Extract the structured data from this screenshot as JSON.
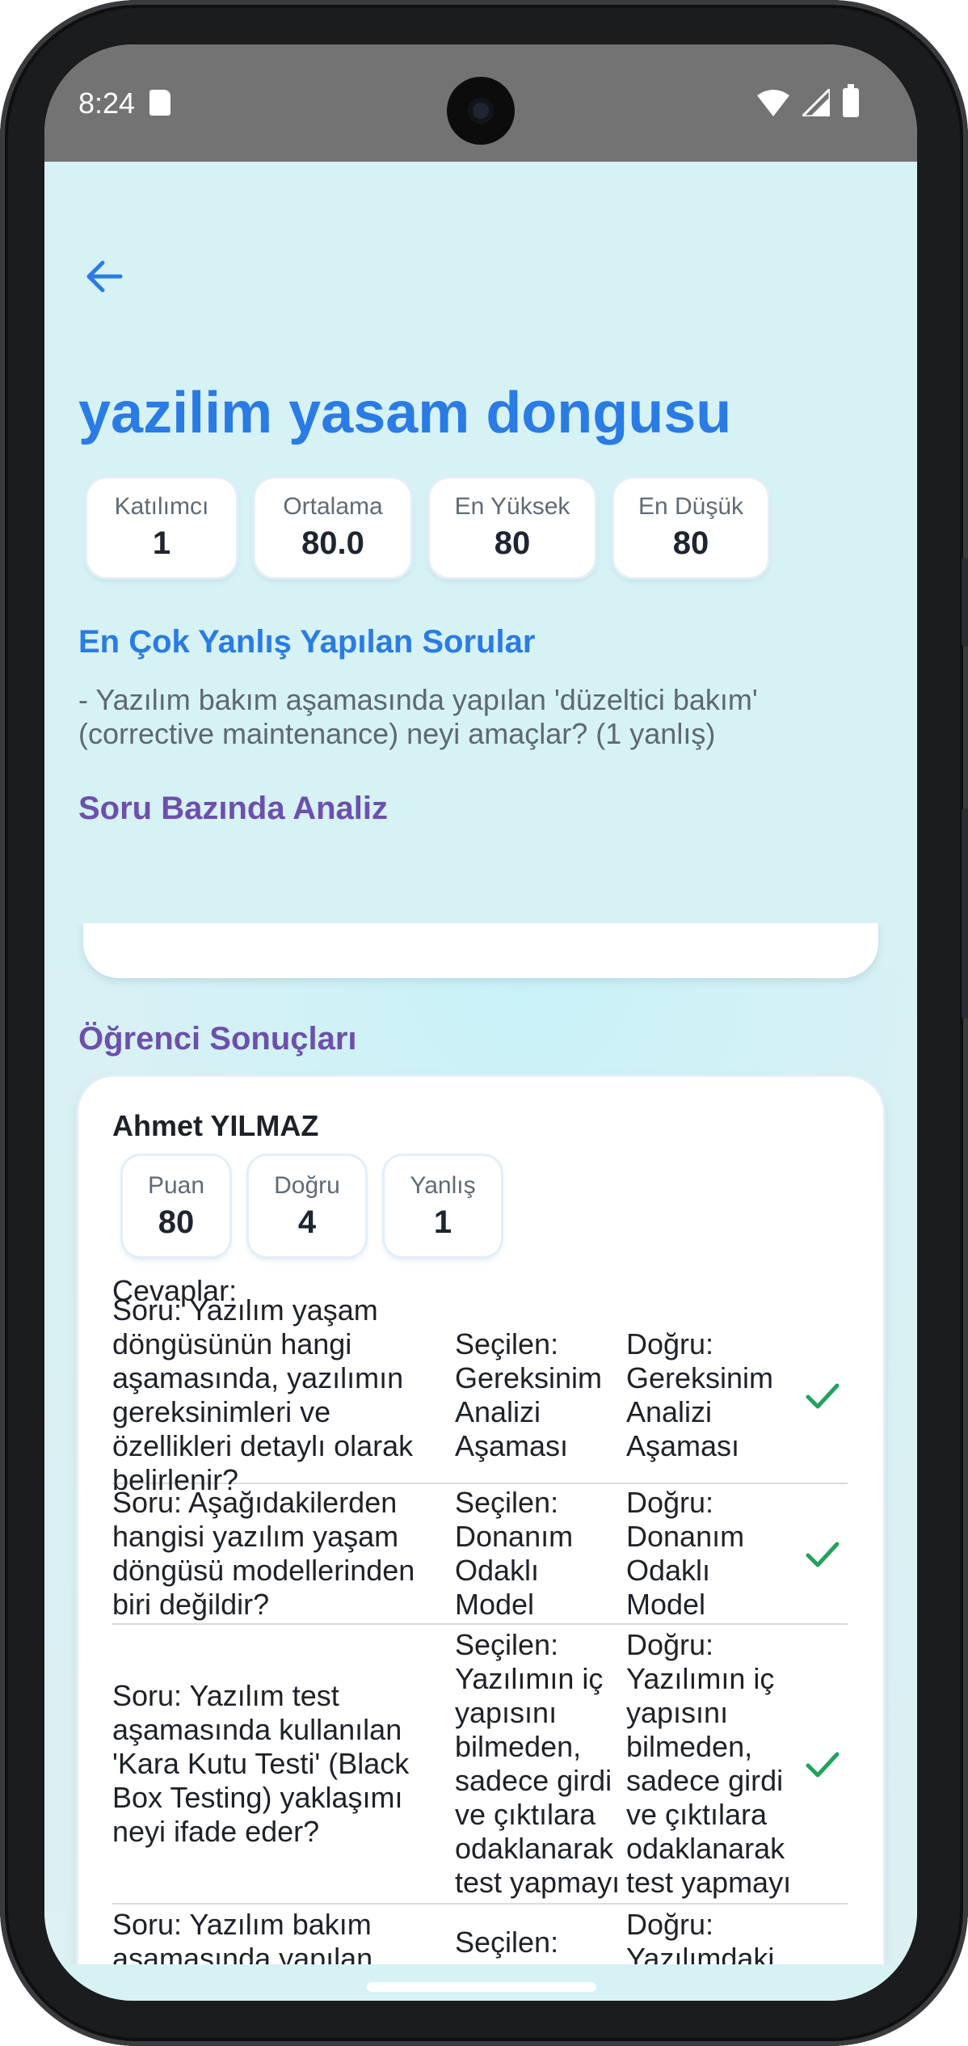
{
  "status_bar": {
    "time": "8:24"
  },
  "page": {
    "title": "yazilim yasam dongusu"
  },
  "stats": [
    {
      "label": "Katılımcı",
      "value": "1"
    },
    {
      "label": "Ortalama",
      "value": "80.0"
    },
    {
      "label": "En Yüksek",
      "value": "80"
    },
    {
      "label": "En Düşük",
      "value": "80"
    }
  ],
  "most_wrong": {
    "heading": "En Çok Yanlış Yapılan Sorular",
    "item": "- Yazılım bakım aşamasında yapılan 'düzeltici bakım' (corrective maintenance) neyi amaçlar? (1 yanlış)"
  },
  "question_analysis": {
    "heading": "Soru Bazında Analiz"
  },
  "student_results": {
    "heading": "Öğrenci Sonuçları"
  },
  "student": {
    "name": "Ahmet YILMAZ",
    "stats": [
      {
        "label": "Puan",
        "value": "80"
      },
      {
        "label": "Doğru",
        "value": "4"
      },
      {
        "label": "Yanlış",
        "value": "1"
      }
    ],
    "answers_label": "Cevaplar:",
    "answers": [
      {
        "question": "Soru: Yazılım yaşam döngüsünün hangi aşamasında, yazılımın gereksinimleri ve özellikleri detaylı olarak belirlenir?",
        "selected": "Seçilen: Gereksinim Analizi Aşaması",
        "correct": "Doğru: Gereksinim Analizi Aşaması",
        "result": "correct"
      },
      {
        "question": "Soru: Aşağıdakilerden hangisi yazılım yaşam döngüsü modellerinden biri değildir?",
        "selected": "Seçilen: Donanım Odaklı Model",
        "correct": "Doğru: Donanım Odaklı Model",
        "result": "correct"
      },
      {
        "question": "Soru: Yazılım test aşamasında kullanılan 'Kara Kutu Testi' (Black Box Testing) yaklaşımı neyi ifade eder?",
        "selected": "Seçilen: Yazılımın iç yapısını bilmeden, sadece girdi ve çıktılara odaklanarak test yapmayı",
        "correct": "Doğru: Yazılımın iç yapısını bilmeden, sadece girdi ve çıktılara odaklanarak test yapmayı",
        "result": "correct"
      },
      {
        "question": "Soru: Yazılım bakım aşamasında yapılan 'düzeltici bakım'",
        "selected": "Seçilen: Yazılımın",
        "correct": "Doğru: Yazılımdaki hataları ve",
        "result": "wrong"
      }
    ]
  },
  "colors": {
    "accent_blue": "#2a7be4",
    "accent_purple": "#6d4fad",
    "correct": "#22a35a",
    "wrong": "#e23b3b"
  }
}
